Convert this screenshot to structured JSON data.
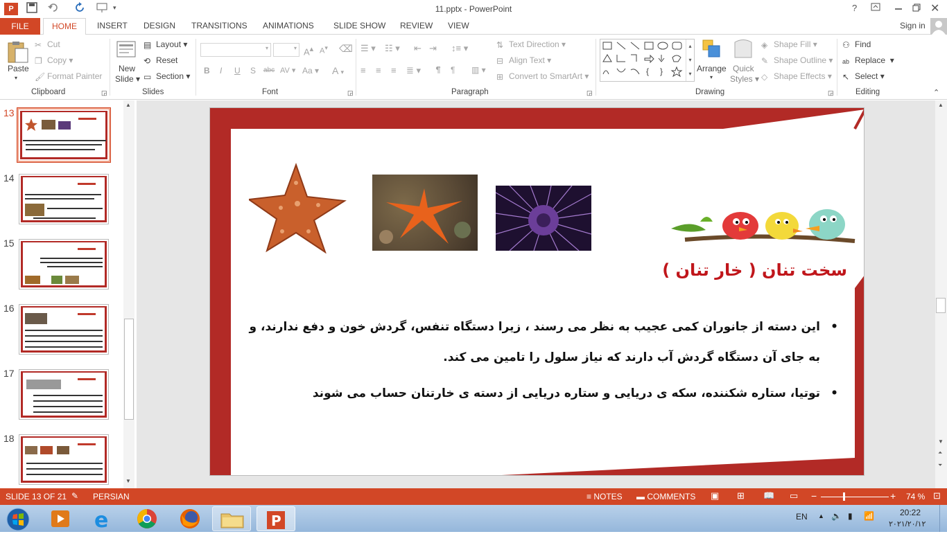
{
  "window": {
    "title": "11.pptx - PowerPoint",
    "help": "?",
    "signin": "Sign in"
  },
  "tabs": [
    "FILE",
    "HOME",
    "INSERT",
    "DESIGN",
    "TRANSITIONS",
    "ANIMATIONS",
    "SLIDE SHOW",
    "REVIEW",
    "VIEW"
  ],
  "ribbon": {
    "clipboard": {
      "paste": "Paste",
      "cut": "Cut",
      "copy": "Copy",
      "format_painter": "Format Painter",
      "label": "Clipboard"
    },
    "slides": {
      "new_slide_1": "New",
      "new_slide_2": "Slide",
      "layout": "Layout",
      "reset": "Reset",
      "section": "Section",
      "label": "Slides"
    },
    "font": {
      "label": "Font",
      "bold": "B",
      "italic": "I",
      "underline": "U",
      "shadow": "S",
      "strike": "abc",
      "case": "Aa"
    },
    "paragraph": {
      "text_direction": "Text Direction",
      "align_text": "Align Text",
      "convert": "Convert to SmartArt",
      "label": "Paragraph"
    },
    "drawing": {
      "arrange": "Arrange",
      "quick_1": "Quick",
      "quick_2": "Styles",
      "shape_fill": "Shape Fill",
      "shape_outline": "Shape Outline",
      "shape_effects": "Shape Effects",
      "label": "Drawing"
    },
    "editing": {
      "find": "Find",
      "replace": "Replace",
      "select": "Select",
      "label": "Editing"
    }
  },
  "thumbnails": [
    {
      "num": "13"
    },
    {
      "num": "14"
    },
    {
      "num": "15"
    },
    {
      "num": "16"
    },
    {
      "num": "17"
    },
    {
      "num": "18"
    }
  ],
  "slide": {
    "title": "سخت تنان ( خار تنان )",
    "bullet1": "این دسته از جانوران کمی عجیب به نظر می رسند ، زیرا دستگاه تنفس، گردش خون و دفع ندارند، و به جای آن دستگاه گردش آب دارند که نیاز سلول را تامین می کند.",
    "bullet2": "توتیا، ستاره شکننده، سکه ی دریایی و ستاره دریایی از دسته ی خارتنان حساب می شوند"
  },
  "status": {
    "slide": "SLIDE 13 OF 21",
    "lang": "PERSIAN",
    "notes": "NOTES",
    "comments": "COMMENTS",
    "zoom": "74 %"
  },
  "taskbar": {
    "lang": "EN",
    "time": "20:22",
    "date": "۲۰۲۱/۲۰/۱۲"
  },
  "colors": {
    "accent": "#d24726",
    "slide_frame": "#b22a26",
    "title_red": "#c0161b"
  }
}
